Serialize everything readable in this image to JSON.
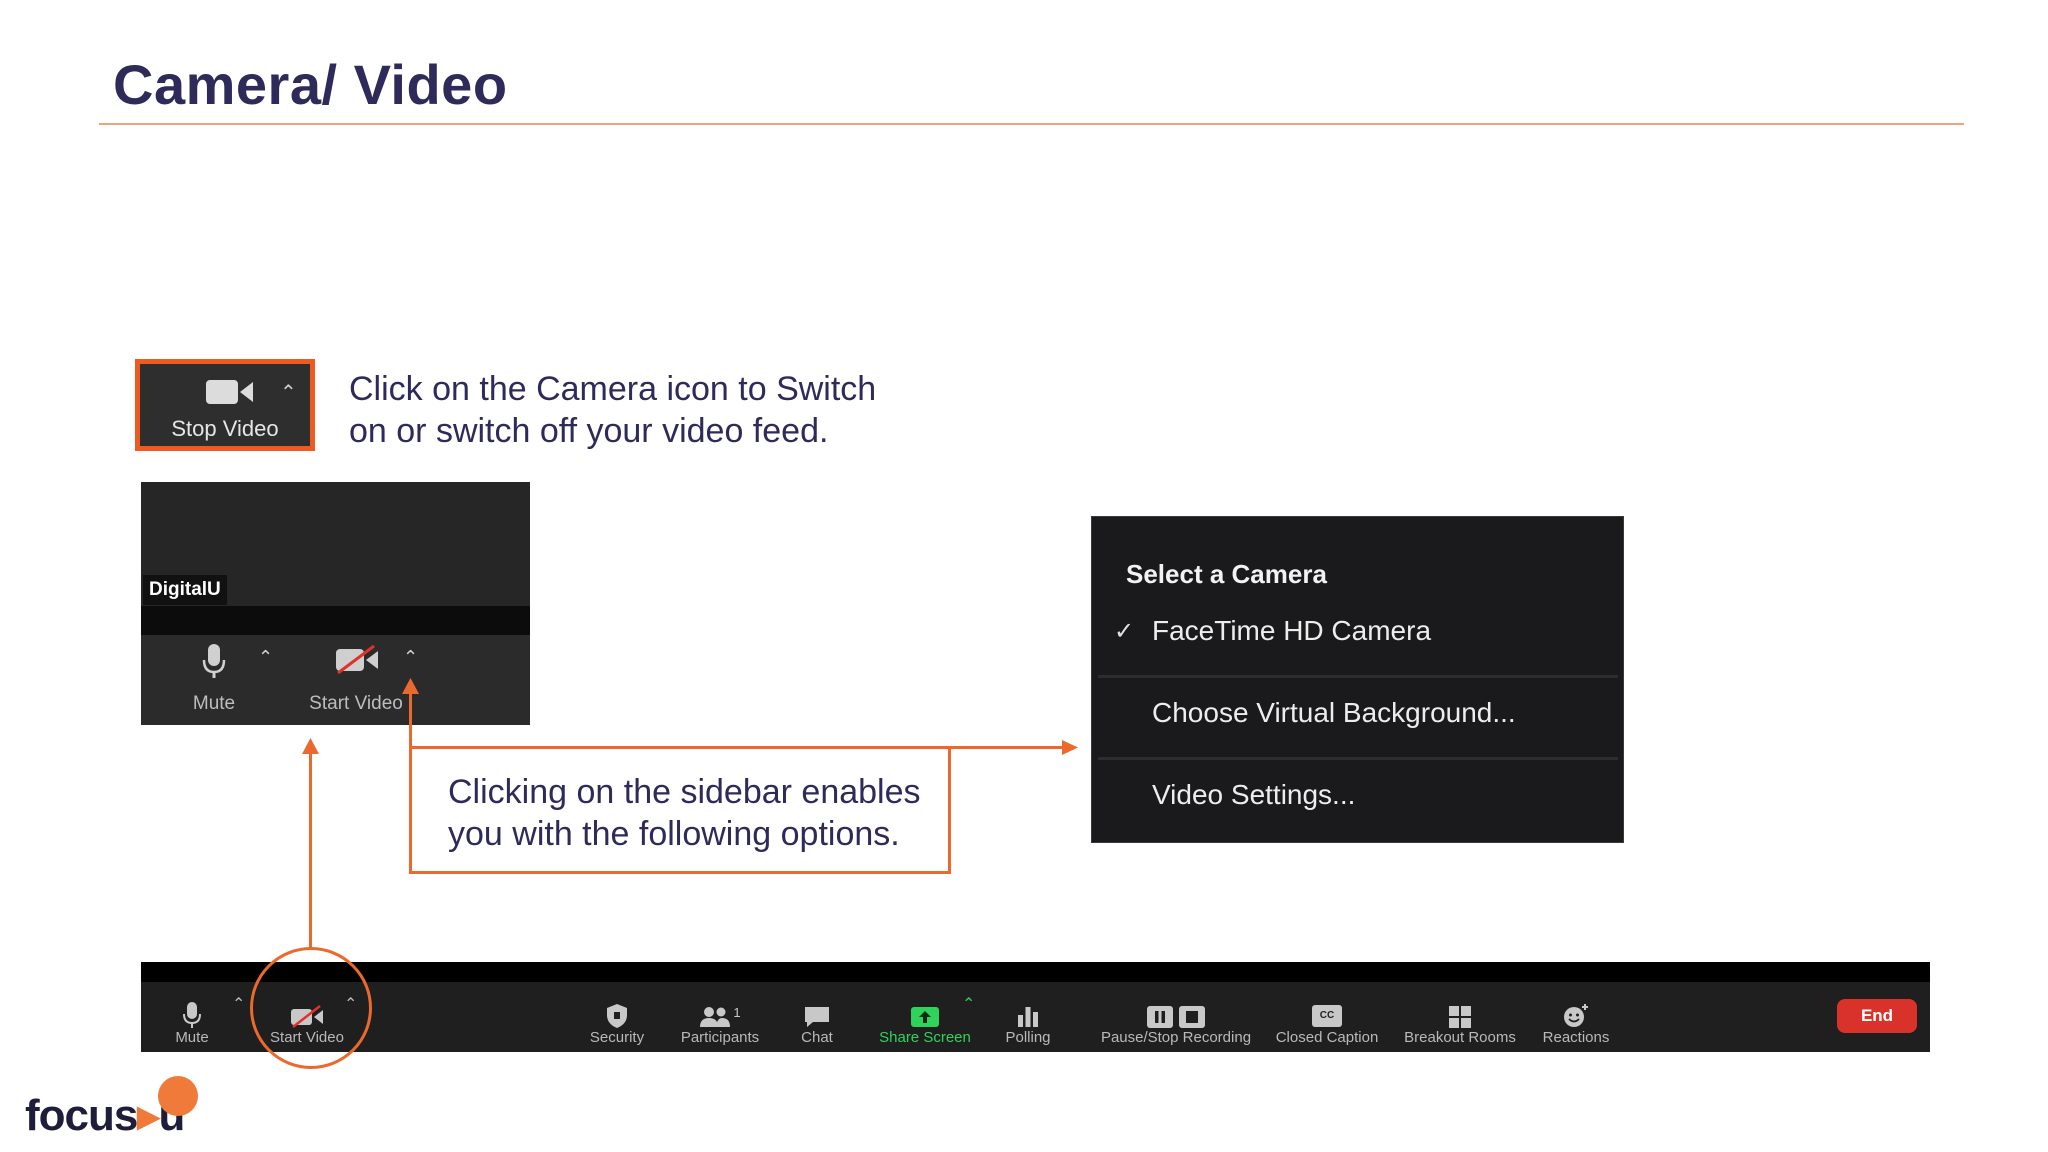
{
  "title": "Camera/ Video",
  "stop_video": {
    "label": "Stop Video"
  },
  "caption_camera_icon": "Click on the Camera icon to Switch on or  switch off your video feed.",
  "tile": {
    "name": "DigitalU",
    "mute_label": "Mute",
    "start_video_label": "Start Video"
  },
  "camera_menu": {
    "header": "Select a Camera",
    "items": [
      "FaceTime HD Camera",
      "Choose Virtual Background...",
      "Video Settings..."
    ],
    "selected_index": 0
  },
  "caption_sidebar": "Clicking  on the sidebar enables you with the following options.",
  "toolbar": {
    "mute": "Mute",
    "start_video": "Start Video",
    "security": "Security",
    "participants": "Participants",
    "participants_count": "1",
    "chat": "Chat",
    "share_screen": "Share Screen",
    "polling": "Polling",
    "recording": "Pause/Stop Recording",
    "closed_caption": "Closed Caption",
    "breakout_rooms": "Breakout Rooms",
    "reactions": "Reactions",
    "end": "End",
    "cc_badge": "CC"
  },
  "logo": {
    "text": "focus",
    "suffix": "u"
  },
  "colors": {
    "accent": "#ea6a2e",
    "title": "#2e2a5a",
    "share_green": "#2fd35b",
    "end_red": "#d9322b"
  }
}
